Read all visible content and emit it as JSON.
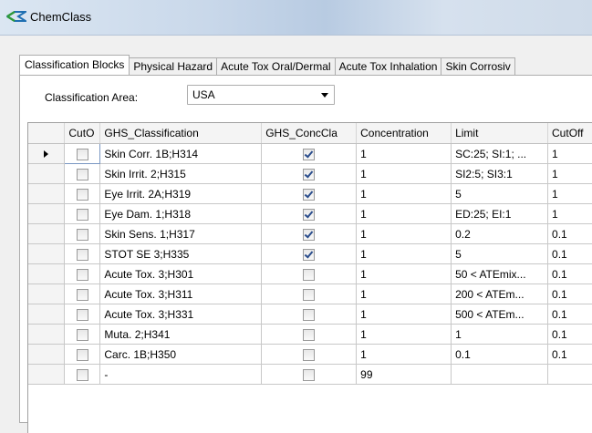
{
  "window": {
    "title": "ChemClass"
  },
  "tabs": [
    {
      "label": "Classification Blocks",
      "active": true
    },
    {
      "label": "Physical Hazard",
      "active": false
    },
    {
      "label": "Acute Tox Oral/Dermal",
      "active": false
    },
    {
      "label": "Acute Tox Inhalation",
      "active": false
    },
    {
      "label": "Skin Corrosiv",
      "active": false
    }
  ],
  "classification_area": {
    "label": "Classification Area:",
    "value": "USA"
  },
  "grid": {
    "columns": [
      "CutO",
      "GHS_Classification",
      "GHS_ConcCla",
      "Concentration",
      "Limit",
      "CutOff"
    ],
    "current_row": 0,
    "rows": [
      {
        "cutoff_checked": false,
        "ghs": "Skin Corr. 1B;H314",
        "conc_checked": true,
        "concentration": "1",
        "limit": "SC:25; SI:1; ...",
        "cutoff": "1"
      },
      {
        "cutoff_checked": false,
        "ghs": "Skin Irrit. 2;H315",
        "conc_checked": true,
        "concentration": "1",
        "limit": "SI2:5; SI3:1",
        "cutoff": "1"
      },
      {
        "cutoff_checked": false,
        "ghs": "Eye Irrit. 2A;H319",
        "conc_checked": true,
        "concentration": "1",
        "limit": "5",
        "cutoff": "1"
      },
      {
        "cutoff_checked": false,
        "ghs": "Eye Dam. 1;H318",
        "conc_checked": true,
        "concentration": "1",
        "limit": "ED:25; EI:1",
        "cutoff": "1"
      },
      {
        "cutoff_checked": false,
        "ghs": "Skin Sens. 1;H317",
        "conc_checked": true,
        "concentration": "1",
        "limit": "0.2",
        "cutoff": "0.1"
      },
      {
        "cutoff_checked": false,
        "ghs": "STOT SE 3;H335",
        "conc_checked": true,
        "concentration": "1",
        "limit": "5",
        "cutoff": "0.1"
      },
      {
        "cutoff_checked": false,
        "ghs": "Acute Tox. 3;H301",
        "conc_checked": false,
        "concentration": "1",
        "limit": "50 < ATEmix...",
        "cutoff": "0.1"
      },
      {
        "cutoff_checked": false,
        "ghs": "Acute Tox. 3;H311",
        "conc_checked": false,
        "concentration": "1",
        "limit": "200 < ATEm...",
        "cutoff": "0.1"
      },
      {
        "cutoff_checked": false,
        "ghs": "Acute Tox. 3;H331",
        "conc_checked": false,
        "concentration": "1",
        "limit": "500 < ATEm...",
        "cutoff": "0.1"
      },
      {
        "cutoff_checked": false,
        "ghs": "Muta. 2;H341",
        "conc_checked": false,
        "concentration": "1",
        "limit": "1",
        "cutoff": "0.1"
      },
      {
        "cutoff_checked": false,
        "ghs": "Carc. 1B;H350",
        "conc_checked": false,
        "concentration": "1",
        "limit": "0.1",
        "cutoff": "0.1"
      },
      {
        "cutoff_checked": false,
        "ghs": "-",
        "conc_checked": false,
        "concentration": "99",
        "limit": "",
        "cutoff": ""
      }
    ]
  }
}
